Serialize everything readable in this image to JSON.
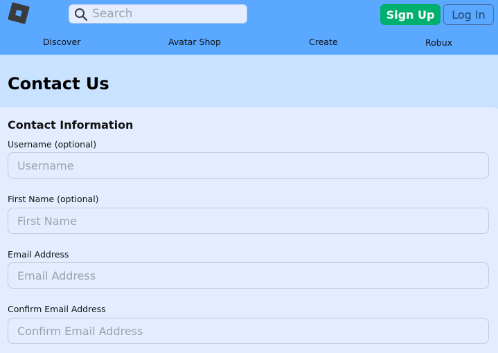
{
  "header": {
    "logo": "roblox-logo",
    "search": {
      "placeholder": "Search",
      "value": ""
    },
    "signup_label": "Sign Up",
    "login_label": "Log In",
    "nav": [
      {
        "label": "Discover"
      },
      {
        "label": "Avatar Shop"
      },
      {
        "label": "Create"
      },
      {
        "label": "Robux"
      }
    ]
  },
  "page": {
    "title": "Contact Us"
  },
  "form": {
    "section_title": "Contact Information",
    "fields": [
      {
        "label": "Username (optional)",
        "placeholder": "Username",
        "value": ""
      },
      {
        "label": "First Name (optional)",
        "placeholder": "First Name",
        "value": ""
      },
      {
        "label": "Email Address",
        "placeholder": "Email Address",
        "value": ""
      },
      {
        "label": "Confirm Email Address",
        "placeholder": "Confirm Email Address",
        "value": ""
      }
    ]
  },
  "colors": {
    "header_bg": "#5aa8ff",
    "signup_bg": "#00b06f",
    "title_band_bg": "#c8e2ff",
    "panel_bg": "#e3edff"
  }
}
